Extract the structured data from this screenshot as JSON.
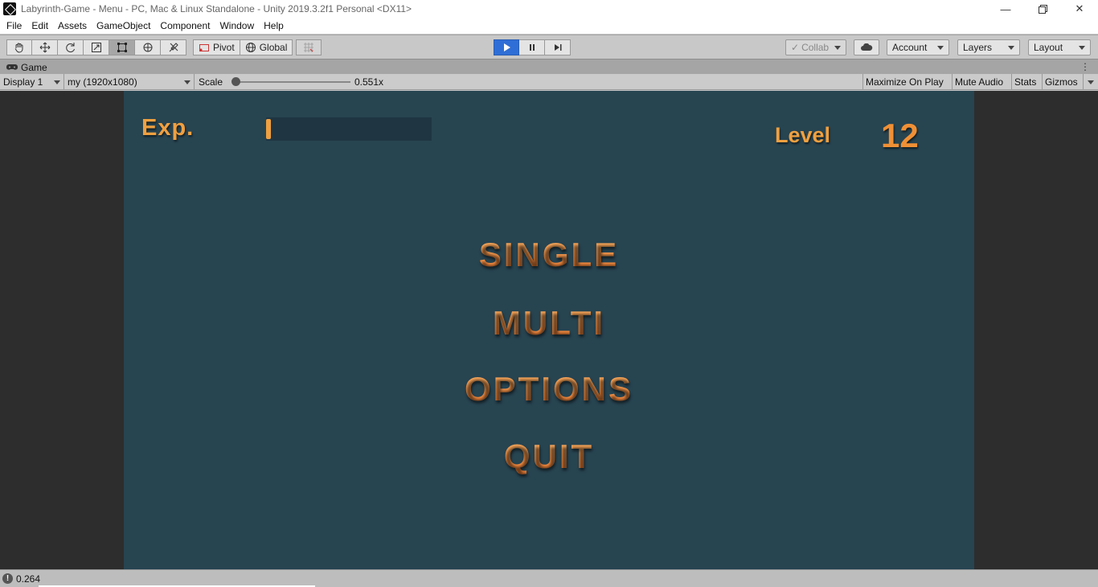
{
  "window": {
    "title": "Labyrinth-Game - Menu - PC, Mac & Linux Standalone - Unity 2019.3.2f1 Personal <DX11>"
  },
  "menu": {
    "items": [
      "File",
      "Edit",
      "Assets",
      "GameObject",
      "Component",
      "Window",
      "Help"
    ]
  },
  "toolbar": {
    "tools": [
      "hand-tool",
      "move-tool",
      "rotate-tool",
      "scale-tool",
      "rect-tool",
      "transform-tool",
      "custom-tool"
    ],
    "pivot_label": "Pivot",
    "global_label": "Global",
    "collab_label": "Collab",
    "account_label": "Account",
    "layers_label": "Layers",
    "layout_label": "Layout"
  },
  "game_tab": {
    "label": "Game"
  },
  "game_bar": {
    "display": "Display 1",
    "resolution": "my (1920x1080)",
    "scale_label": "Scale",
    "scale_value": "0.551x",
    "scale_fraction": 0.03,
    "maximize_label": "Maximize On Play",
    "mute_label": "Mute Audio",
    "stats_label": "Stats",
    "gizmos_label": "Gizmos"
  },
  "game": {
    "exp_label": "Exp.",
    "exp_fraction": 0.03,
    "level_label": "Level",
    "level_value": "12",
    "menu_buttons": [
      "SINGLE",
      "MULTI",
      "OPTIONS",
      "QUIT"
    ],
    "colors": {
      "background": "#274451",
      "accent": "#f58f3c",
      "bar_track": "#1f3642"
    }
  },
  "status": {
    "value": "0.264"
  }
}
